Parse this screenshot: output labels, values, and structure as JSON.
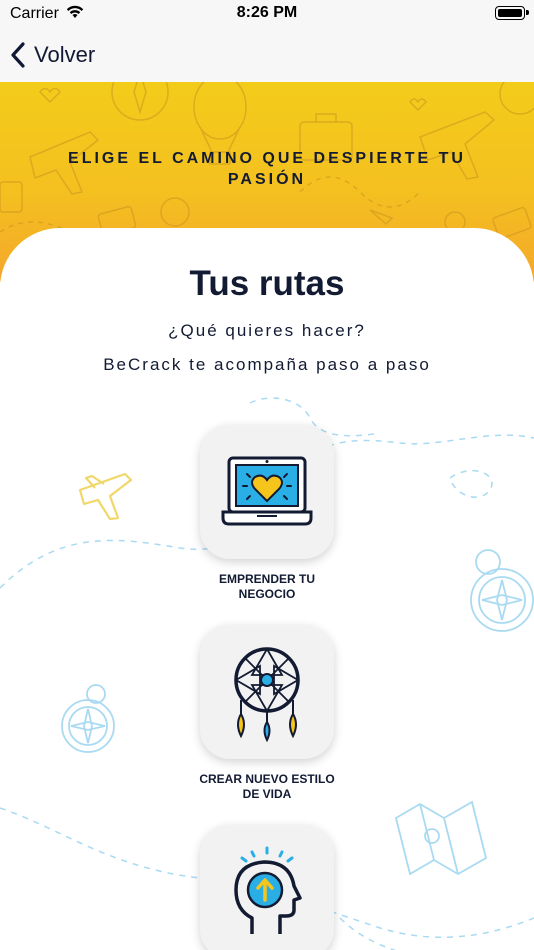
{
  "status_bar": {
    "carrier": "Carrier",
    "time": "8:26 PM"
  },
  "nav": {
    "back_label": "Volver"
  },
  "hero": {
    "title": "ELIGE EL CAMINO QUE DESPIERTE TU PASIÓN"
  },
  "main": {
    "title": "Tus rutas",
    "subtitle_1": "¿Qué quieres hacer?",
    "subtitle_2": "BeCrack te acompaña paso a paso"
  },
  "routes": [
    {
      "label": "EMPRENDER TU NEGOCIO",
      "icon": "laptop-heart-icon"
    },
    {
      "label": "CREAR NUEVO ESTILO DE VIDA",
      "icon": "dreamcatcher-icon"
    },
    {
      "label": "",
      "icon": "head-arrow-up-icon"
    }
  ],
  "colors": {
    "navy": "#131b33",
    "yellow": "#f3cc1a",
    "orange": "#f4a72a",
    "sky": "#29aee6",
    "doodle": "#a9daf2"
  }
}
